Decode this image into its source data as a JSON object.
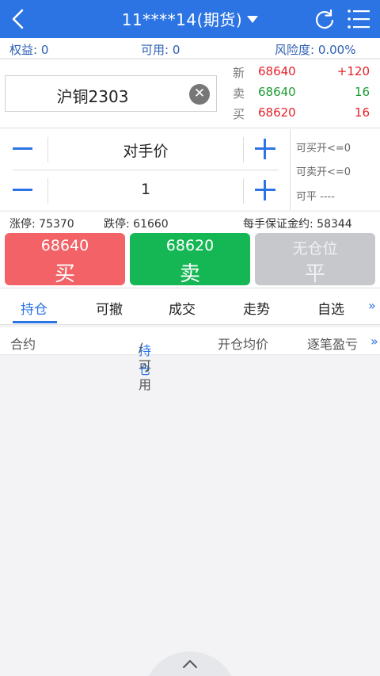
{
  "header": {
    "title": "11****14(期货)",
    "back_icon": "back-chevron-icon",
    "refresh_icon": "refresh-icon",
    "menu_icon": "list-menu-icon"
  },
  "account": {
    "equity": "权益: 0",
    "available": "可用: 0",
    "risk": "风险度:  0.00%"
  },
  "contract": {
    "name": "沪铜2303",
    "clear_icon": "clear-x-icon"
  },
  "quote": [
    {
      "label": "新",
      "price": "68640",
      "change": "+120",
      "price_color": "#e5212b",
      "change_color": "#e5212b"
    },
    {
      "label": "卖",
      "price": "68640",
      "change": "16",
      "price_color": "#1a9a33",
      "change_color": "#1a9a33"
    },
    {
      "label": "买",
      "price": "68620",
      "change": "16",
      "price_color": "#e5212b",
      "change_color": "#e5212b"
    }
  ],
  "order": {
    "price_type": "对手价",
    "quantity": "1",
    "avail_buy_open": "可买开<=0",
    "avail_sell_open": "可卖开<=0",
    "avail_close": "可平 ----"
  },
  "limits": {
    "limit_up": "涨停: 75370",
    "limit_down": "跌停: 61660",
    "margin": "每手保证金约: 58344"
  },
  "actions": {
    "buy": {
      "price": "68640",
      "label": "买",
      "color": "#f26266"
    },
    "sell": {
      "price": "68620",
      "label": "卖",
      "color": "#15b754"
    },
    "close": {
      "price": "无仓位",
      "label": "平",
      "color": "#c7c8cc"
    }
  },
  "tabs": {
    "items": [
      "持仓",
      "可撤",
      "成交",
      "走势",
      "自选"
    ],
    "active": "持仓",
    "more": "»"
  },
  "table_header": {
    "contract": "合约",
    "position_active": "持仓",
    "position_rest": "/可用",
    "avg_price": "开仓均价",
    "pnl": "逐笔盈亏",
    "more": "»"
  },
  "accent_color": "#2c74e3"
}
